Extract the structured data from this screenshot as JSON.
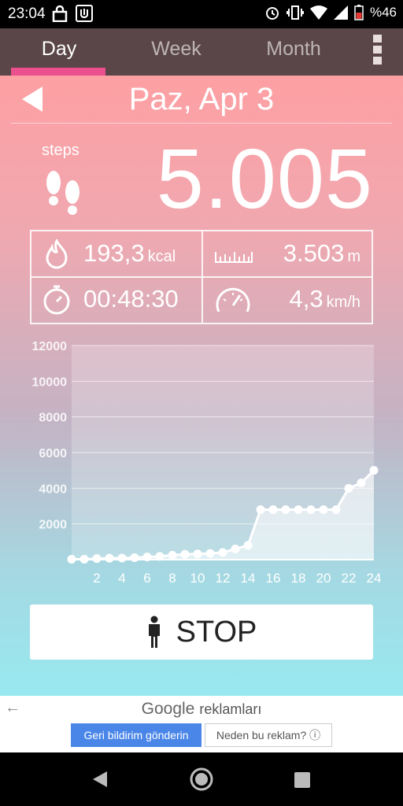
{
  "status_bar": {
    "time": "23:04",
    "battery_text": "%46",
    "icons": [
      "lock-icon",
      "notification-app-icon",
      "alarm-icon",
      "vibrate-icon",
      "wifi-icon",
      "signal-icon",
      "battery-icon"
    ]
  },
  "tabs": [
    {
      "label": "Day",
      "active": true
    },
    {
      "label": "Week",
      "active": false
    },
    {
      "label": "Month",
      "active": false
    }
  ],
  "date_title": "Paz, Apr 3",
  "steps": {
    "label": "steps",
    "value": "5.005"
  },
  "stats": {
    "calories": {
      "value": "193,3",
      "unit": "kcal"
    },
    "distance": {
      "value": "3.503",
      "unit": "m"
    },
    "duration": {
      "value": "00:48:30",
      "unit": ""
    },
    "speed": {
      "value": "4,3",
      "unit": "km/h"
    }
  },
  "chart_data": {
    "type": "line",
    "x": [
      0,
      1,
      2,
      3,
      4,
      5,
      6,
      7,
      8,
      9,
      10,
      11,
      12,
      13,
      14,
      15,
      16,
      17,
      18,
      19,
      20,
      21,
      22,
      23,
      24
    ],
    "values": [
      20,
      60,
      80,
      90,
      110,
      150,
      180,
      250,
      300,
      320,
      350,
      400,
      600,
      800,
      2800,
      2800,
      2800,
      2800,
      2800,
      2800,
      2800,
      4000,
      4300,
      5005
    ],
    "point_x": [
      0,
      1,
      2,
      3,
      4,
      5,
      6,
      7,
      8,
      9,
      10,
      11,
      12,
      13,
      14,
      15,
      16,
      17,
      18,
      19,
      20,
      21,
      22,
      23,
      24
    ],
    "point_y": [
      20,
      20,
      60,
      80,
      90,
      110,
      150,
      180,
      250,
      300,
      320,
      350,
      400,
      600,
      800,
      2800,
      2800,
      2800,
      2800,
      2800,
      2800,
      2800,
      4000,
      4300,
      5005
    ],
    "xticks": [
      "2",
      "4",
      "6",
      "8",
      "10",
      "12",
      "14",
      "16",
      "18",
      "20",
      "22",
      "24"
    ],
    "yticks": [
      "2000",
      "4000",
      "6000",
      "8000",
      "10000",
      "12000"
    ],
    "ylim": [
      0,
      12000
    ],
    "xlim": [
      0,
      24
    ],
    "grid": true
  },
  "stop_button": {
    "label": "STOP"
  },
  "ad": {
    "brand": "Google",
    "header": "reklamları",
    "feedback_label": "Geri bildirim gönderin",
    "why_label": "Neden bu reklam? ⓘ"
  },
  "nav": {
    "icons": [
      "back-nav-icon",
      "home-nav-icon",
      "recents-nav-icon"
    ]
  }
}
